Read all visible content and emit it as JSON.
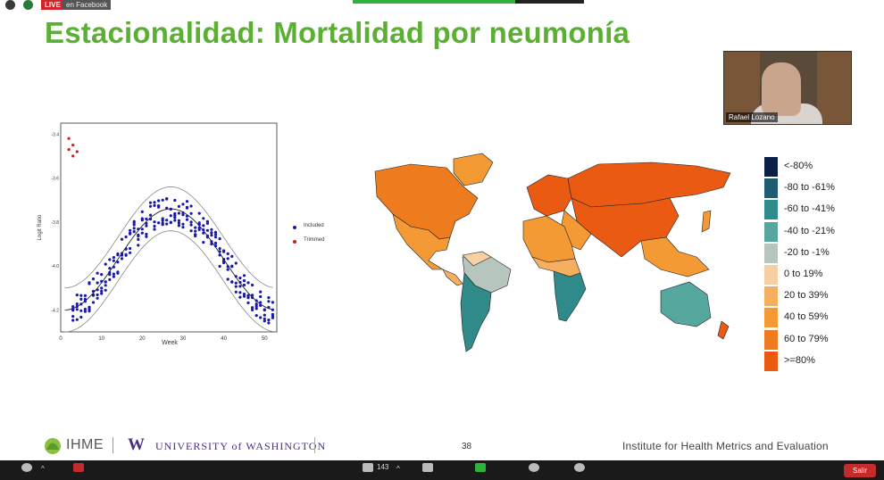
{
  "header": {
    "live_label": "LIVE",
    "facebook_label": "en Facebook"
  },
  "slide": {
    "title": "Estacionalidad: Mortalidad por neumonía",
    "page_number": "38",
    "institute": "Institute for Health Metrics and Evaluation",
    "ihme": "IHME",
    "uw_w": "W",
    "uw_name": "UNIVERSITY of WASHINGTON"
  },
  "video": {
    "participant_name": "Rafael Lozano"
  },
  "chart_data": {
    "type": "scatter",
    "xlabel": "Week",
    "ylabel": "Logit Ratio",
    "xticks": [
      "0",
      "10",
      "20",
      "30",
      "40",
      "50"
    ],
    "yticks": [
      "-3.4",
      "-3.6",
      "-3.8",
      "-4.0",
      "-4.2"
    ],
    "xlim": [
      0,
      53
    ],
    "ylim": [
      -4.3,
      -3.35
    ],
    "legend": [
      {
        "name": "Included",
        "color": "#1a1aa8"
      },
      {
        "name": "Trimmed",
        "color": "#c81e1e"
      }
    ],
    "legend_position": "right"
  },
  "map_legend": [
    {
      "label": "<-80%",
      "color": "#0b1f47"
    },
    {
      "label": "-80 to -61%",
      "color": "#1d5e6e"
    },
    {
      "label": "-60 to -41%",
      "color": "#2f8a89"
    },
    {
      "label": "-40 to -21%",
      "color": "#56a79e"
    },
    {
      "label": "-20 to -1%",
      "color": "#b7c6bc"
    },
    {
      "label": "0 to 19%",
      "color": "#f6cfa5"
    },
    {
      "label": "20 to 39%",
      "color": "#f6ae60"
    },
    {
      "label": "40 to 59%",
      "color": "#f39a35"
    },
    {
      "label": "60 to 79%",
      "color": "#ef7b1f"
    },
    {
      "label": ">=80%",
      "color": "#ea5a12"
    }
  ],
  "zoom": {
    "participants_count": "143",
    "exit_label": "Salir"
  }
}
